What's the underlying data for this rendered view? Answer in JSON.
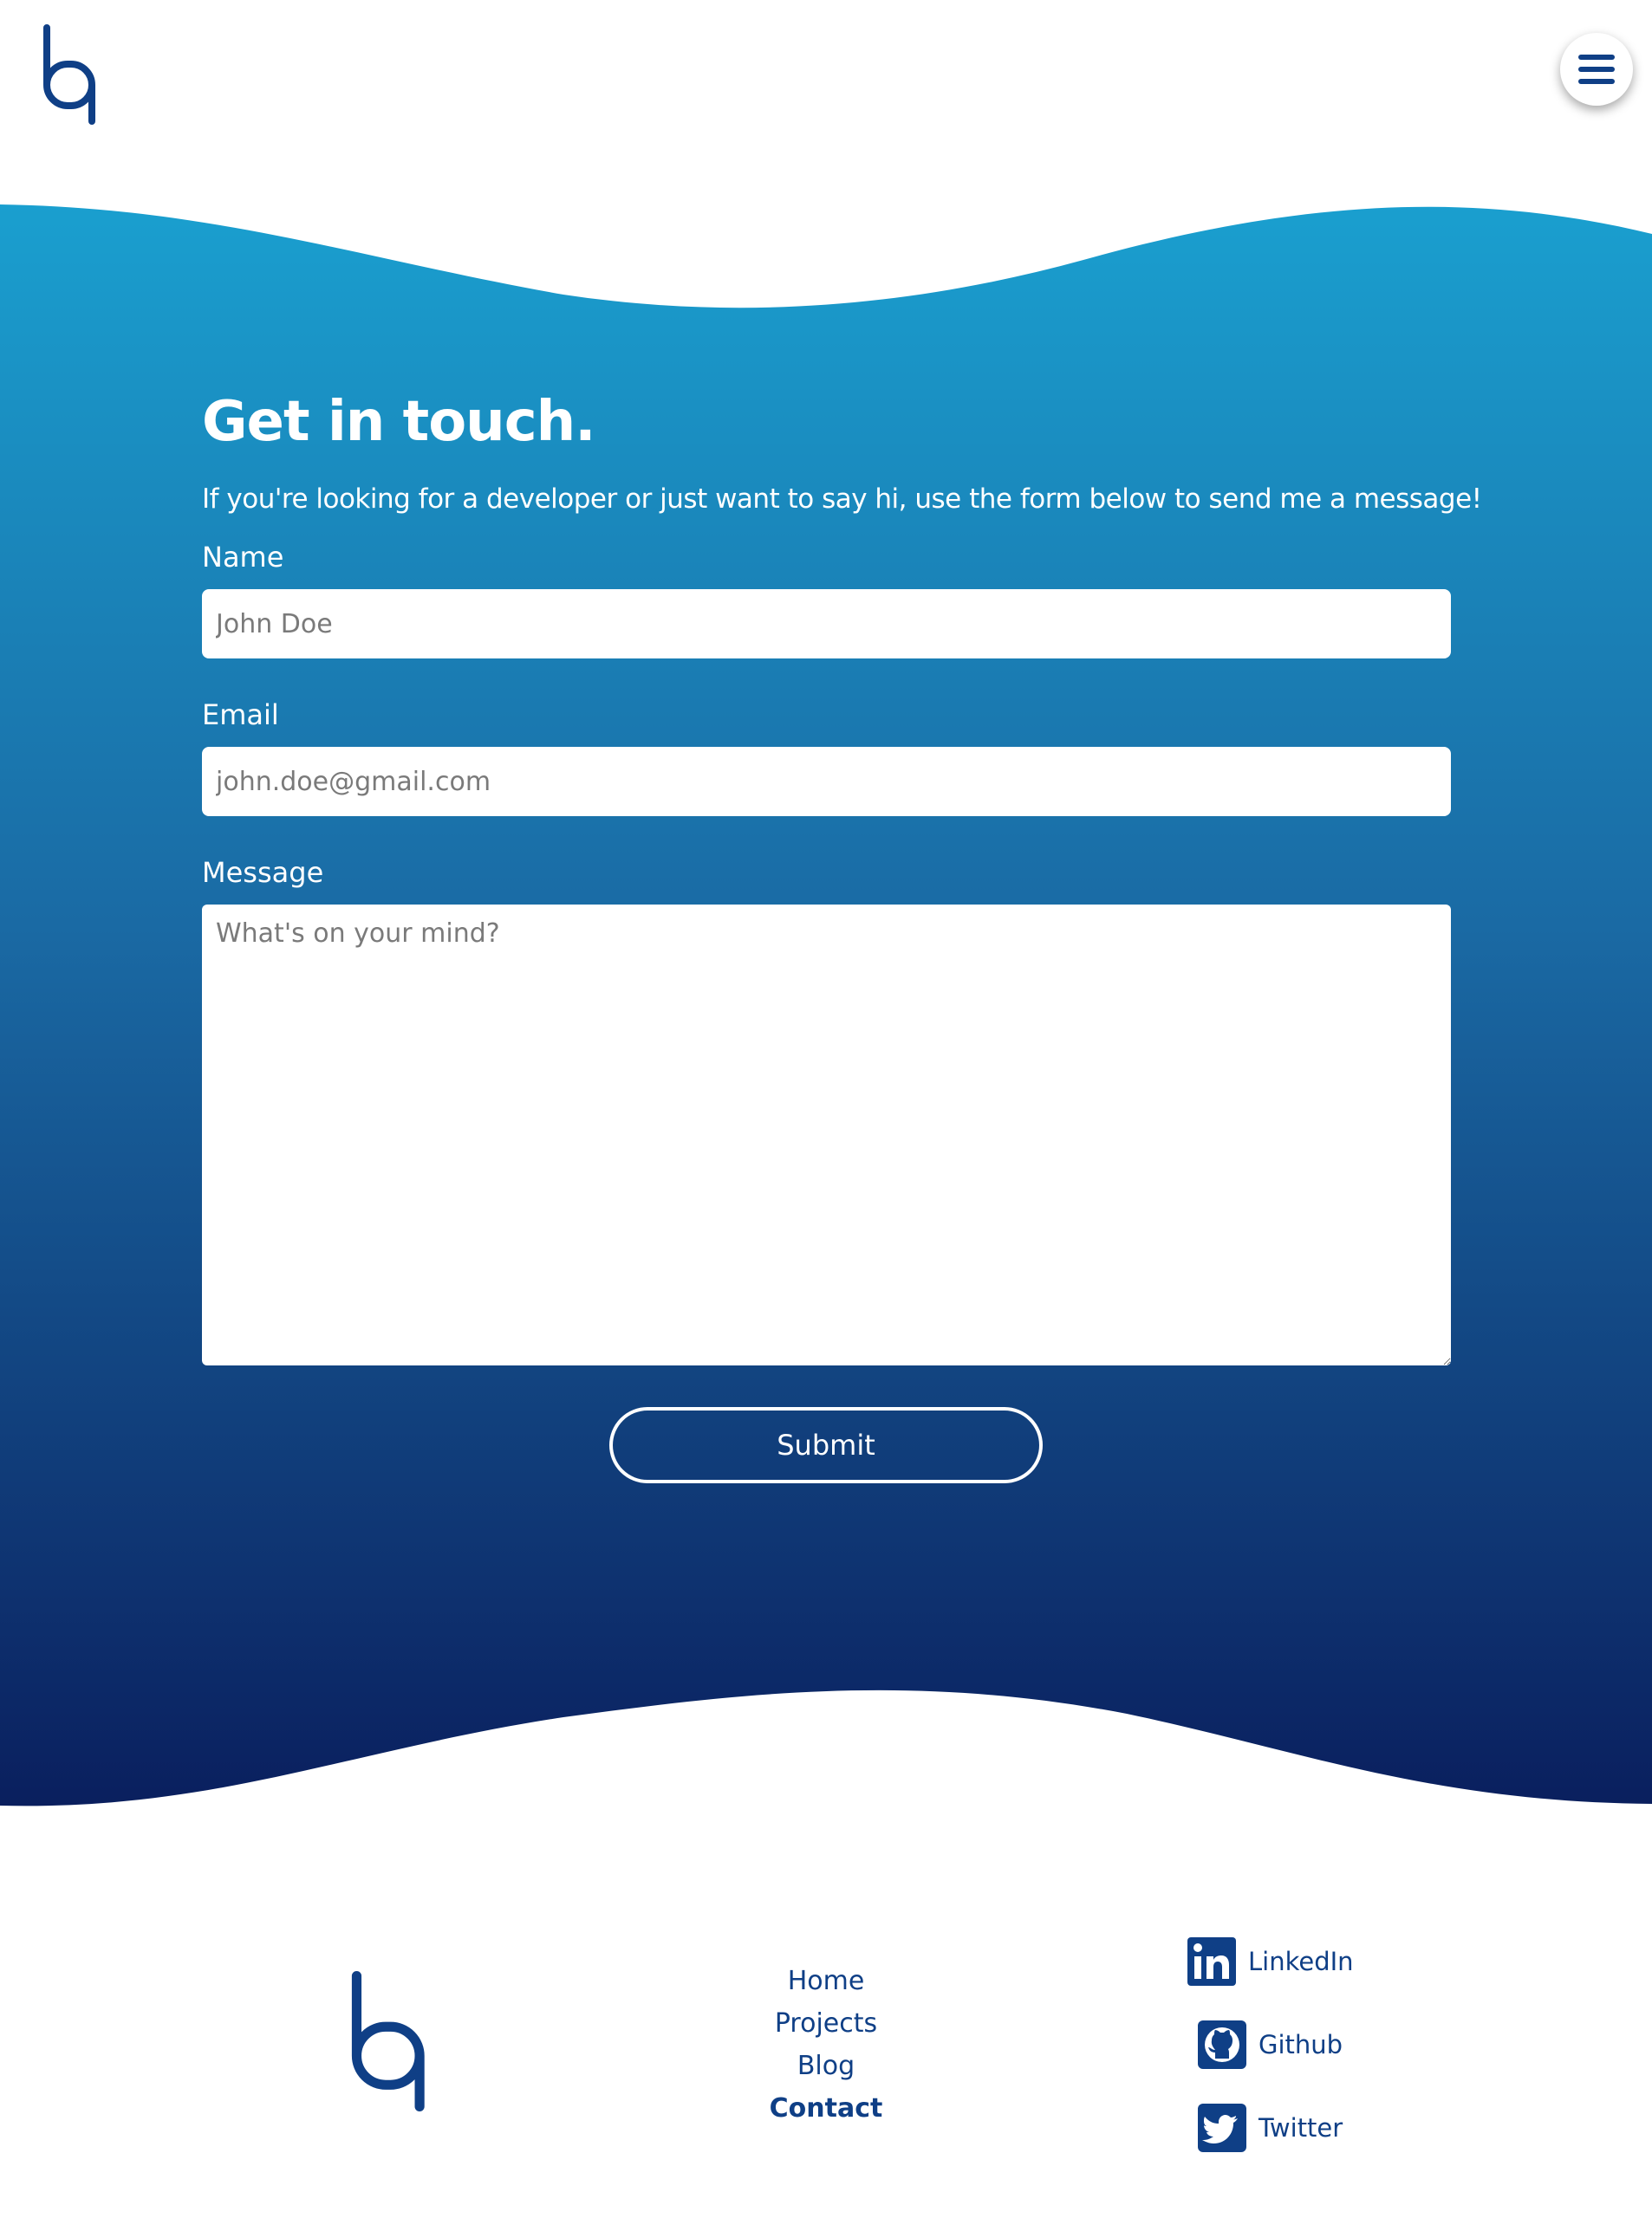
{
  "header": {
    "logo_icon": "bq-logo-icon",
    "menu_icon": "hamburger-menu-icon"
  },
  "colors": {
    "brand": "#0f3f86",
    "gradient_top": "#1a9fcf",
    "gradient_bottom": "#0a1f5e",
    "text_on_blue": "#ffffff"
  },
  "contact": {
    "title": "Get in touch.",
    "subtitle": "If you're looking for a developer or just want to say hi, use the form below to send me a message!",
    "fields": {
      "name": {
        "label": "Name",
        "placeholder": "John Doe",
        "value": ""
      },
      "email": {
        "label": "Email",
        "placeholder": "john.doe@gmail.com",
        "value": ""
      },
      "message": {
        "label": "Message",
        "placeholder": "What's on your mind?",
        "value": ""
      }
    },
    "submit_label": "Submit"
  },
  "footer": {
    "logo_icon": "bq-logo-icon",
    "nav": [
      {
        "label": "Home",
        "active": false
      },
      {
        "label": "Projects",
        "active": false
      },
      {
        "label": "Blog",
        "active": false
      },
      {
        "label": "Contact",
        "active": true
      }
    ],
    "social": [
      {
        "label": "LinkedIn",
        "icon": "linkedin-icon"
      },
      {
        "label": "Github",
        "icon": "github-icon"
      },
      {
        "label": "Twitter",
        "icon": "twitter-icon"
      }
    ]
  }
}
